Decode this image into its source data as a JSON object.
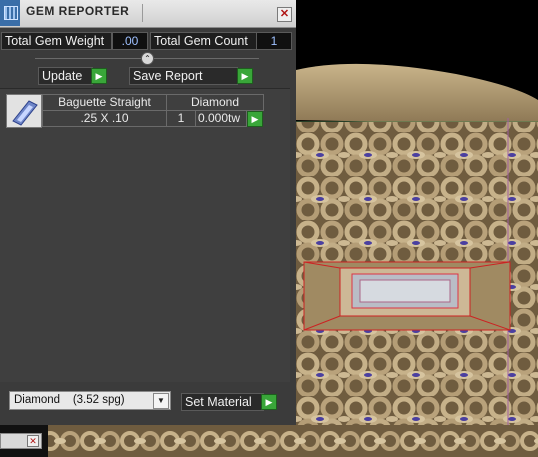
{
  "window": {
    "title": "GEM REPORTER",
    "close_glyph": "✕"
  },
  "summary": {
    "total_weight_label": "Total Gem Weight",
    "total_weight_value": ".00",
    "total_count_label": "Total Gem Count",
    "total_count_value": "1"
  },
  "toolbar": {
    "collapse_glyph": "⌃",
    "update_label": "Update",
    "save_report_label": "Save Report",
    "go_glyph": "▶"
  },
  "gems": [
    {
      "shape": "Baguette Straight",
      "material": "Diamond",
      "size": ".25 X .10",
      "count": "1",
      "weight": "0.000tw"
    }
  ],
  "material": {
    "selected_name": "Diamond",
    "selected_density": "(3.52 spg)",
    "set_label": "Set Material"
  },
  "minimized_window": {
    "close_glyph": "✕"
  },
  "colors": {
    "accent_green": "#39a639",
    "value_blue": "#9ec0ff",
    "gold_model": "#a38d68"
  }
}
